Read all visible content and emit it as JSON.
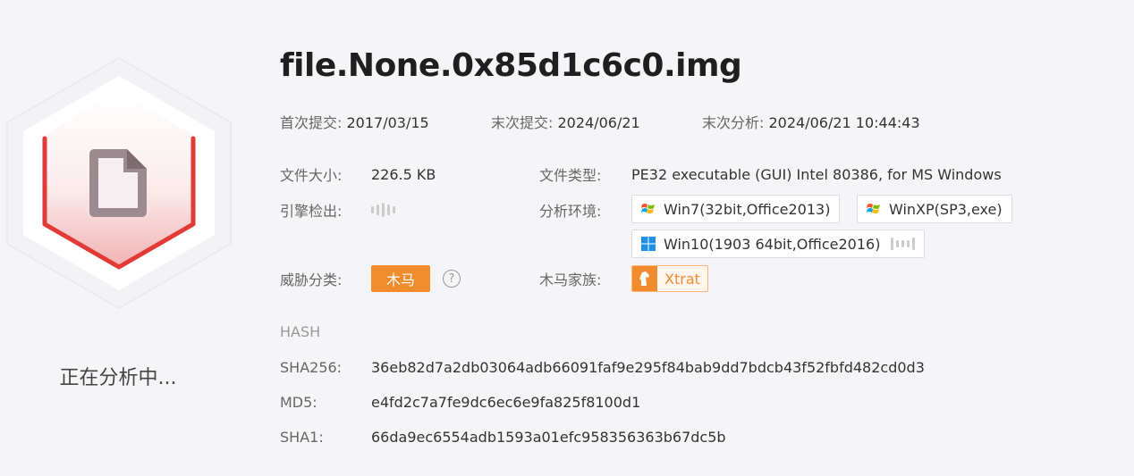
{
  "left_panel": {
    "status_text": "正在分析中...",
    "icon": "file-icon"
  },
  "file": {
    "title": "file.None.0x85d1c6c0.img"
  },
  "dates": {
    "first_submit_label": "首次提交:",
    "first_submit_value": "2017/03/15",
    "last_submit_label": "末次提交:",
    "last_submit_value": "2024/06/21",
    "last_analysis_label": "末次分析:",
    "last_analysis_value": "2024/06/21 10:44:43"
  },
  "details": {
    "file_size_label": "文件大小:",
    "file_size_value": "226.5 KB",
    "file_type_label": "文件类型:",
    "file_type_value": "PE32 executable (GUI) Intel 80386, for MS Windows",
    "engine_label": "引擎检出:",
    "env_label": "分析环境:",
    "environments": [
      {
        "label": "Win7(32bit,Office2013)",
        "icon": "windows-xp-icon"
      },
      {
        "label": "WinXP(SP3,exe)",
        "icon": "windows-xp-icon"
      },
      {
        "label": "Win10(1903 64bit,Office2016)",
        "icon": "windows-10-icon"
      }
    ],
    "threat_label": "威胁分类:",
    "threat_value": "木马",
    "family_label": "木马家族:",
    "family_value": "Xtrat"
  },
  "hash": {
    "heading": "HASH",
    "sha256_label": "SHA256:",
    "sha256_value": "36eb82d7a2db03064adb66091faf9e295f84bab9dd7bdcb43f52fbfd482cd0d3",
    "md5_label": "MD5:",
    "md5_value": "e4fd2c7a7fe9dc6ec6e9fa825f8100d1",
    "sha1_label": "SHA1:",
    "sha1_value": "66da9ec6554adb1593a01efc958356363b67dc5b"
  },
  "colors": {
    "accent_orange": "#f08c2e",
    "hex_red": "#e23a36"
  }
}
